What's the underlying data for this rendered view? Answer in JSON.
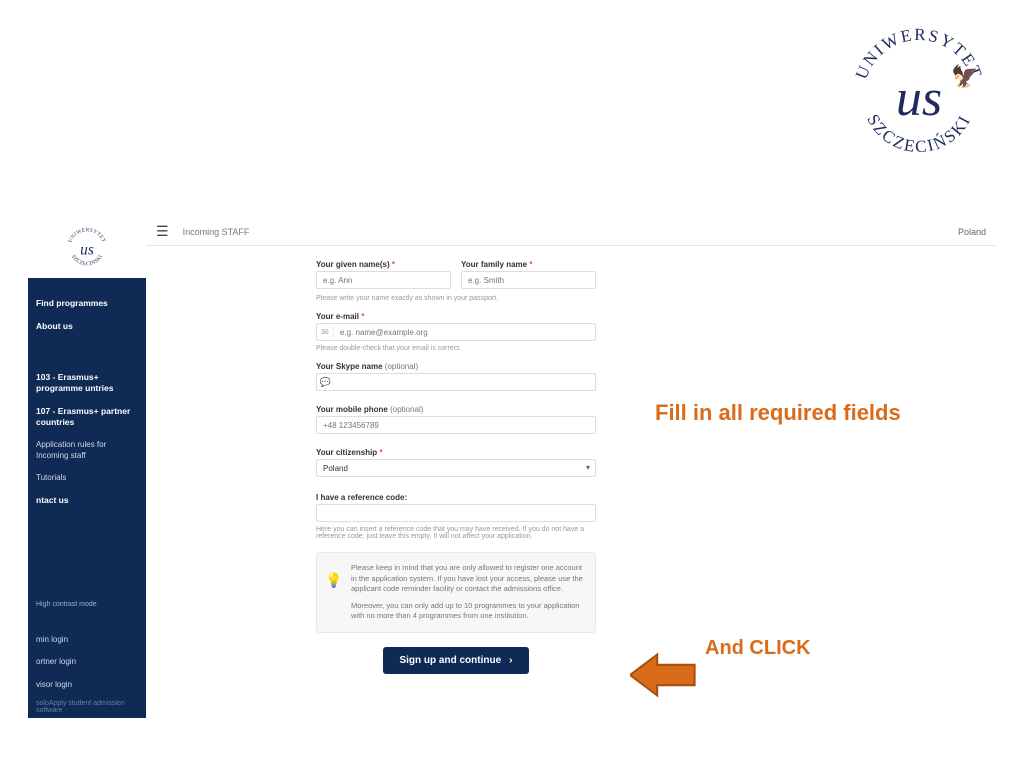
{
  "logo_text": {
    "top": "UNIWERSYTET",
    "bottom": "SZCZECIŃSKI",
    "mono": "us"
  },
  "topbar": {
    "breadcrumb": "Incoming STAFF",
    "right": "Poland"
  },
  "sidebar": {
    "find": "Find programmes",
    "about": "About us",
    "k103": "103 - Erasmus+ programme untries",
    "k107": "107 - Erasmus+ partner countries",
    "apprules": "Application rules for Incoming staff",
    "tutorials": "Tutorials",
    "contact": "ntact us",
    "hcm": "High contrast mode",
    "login1": "min login",
    "login2": "ortner login",
    "login3": "visor login",
    "footer": "soloApply student admission software"
  },
  "form": {
    "given_label": "Your given name(s)",
    "given_ph": "e.g. Ann",
    "family_label": "Your family name",
    "family_ph": "e.g. Smith",
    "name_help": "Please write your name exactly as shown in your passport.",
    "email_label": "Your e-mail",
    "email_ph": "e.g. name@example.org",
    "email_help": "Please double-check that your email is correct.",
    "skype_label": "Your Skype name",
    "skype_opt": "(optional)",
    "mobile_label": "Your mobile phone",
    "mobile_opt": "(optional)",
    "mobile_ph": "+48 123456789",
    "citizen_label": "Your citizenship",
    "citizen_value": "Poland",
    "ref_label": "I have a reference code:",
    "ref_help": "Here you can insert a reference code that you may have received. If you do not have a reference code, just leave this empty. It will not affect your application.",
    "notice1": "Please keep in mind that you are only allowed to register one account in the application system. If you have lost your access, please use the applicant code reminder facility or contact the admissions office.",
    "notice2": "Moreover, you can only add up to 10 programmes to your application with no more than 4 programmes from one institution.",
    "signup": "Sign up and continue"
  },
  "annotations": {
    "fill": "Fill in all required fields",
    "click": "And CLICK"
  }
}
